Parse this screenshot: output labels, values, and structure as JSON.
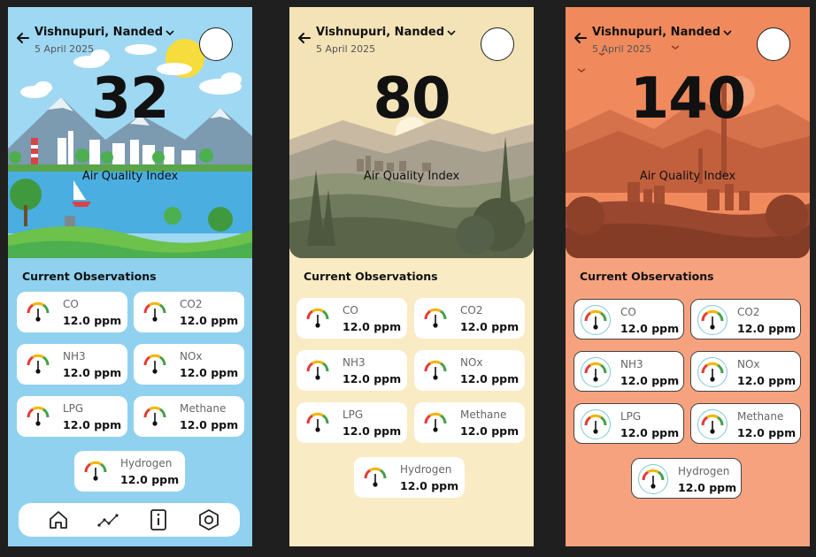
{
  "screens": [
    {
      "location": "Vishnupuri, Nanded",
      "date": "5 April 2025",
      "aqi": "32",
      "aqi_label": "Air Quality Index",
      "observations_title": "Current Observations",
      "theme": {
        "bg": "#8fd1ef",
        "sky": "#9fd8f3"
      },
      "observations": [
        {
          "name": "CO",
          "value": "12.0 ppm"
        },
        {
          "name": "CO2",
          "value": "12.0 ppm"
        },
        {
          "name": "NH3",
          "value": "12.0 ppm"
        },
        {
          "name": "NOx",
          "value": "12.0 ppm"
        },
        {
          "name": "LPG",
          "value": "12.0 ppm"
        },
        {
          "name": "Methane",
          "value": "12.0 ppm"
        },
        {
          "name": "Hydrogen",
          "value": "12.0 ppm"
        }
      ],
      "nav": [
        "home-icon",
        "chart-icon",
        "info-icon",
        "settings-icon"
      ]
    },
    {
      "location": "Vishnupuri, Nanded",
      "date": "5 April 2025",
      "aqi": "80",
      "aqi_label": "Air Quality Index",
      "observations_title": "Current Observations",
      "theme": {
        "bg": "#f9ebc3",
        "sky": "#f3e3b6"
      },
      "observations": [
        {
          "name": "CO",
          "value": "12.0 ppm"
        },
        {
          "name": "CO2",
          "value": "12.0 ppm"
        },
        {
          "name": "NH3",
          "value": "12.0 ppm"
        },
        {
          "name": "NOx",
          "value": "12.0 ppm"
        },
        {
          "name": "LPG",
          "value": "12.0 ppm"
        },
        {
          "name": "Methane",
          "value": "12.0 ppm"
        },
        {
          "name": "Hydrogen",
          "value": "12.0 ppm"
        }
      ]
    },
    {
      "location": "Vishnupuri, Nanded",
      "date": "5 April 2025",
      "aqi": "140",
      "aqi_label": "Air Quality Index",
      "observations_title": "Current Observations",
      "theme": {
        "bg": "#f7a27f",
        "sky": "#f08a5d"
      },
      "observations": [
        {
          "name": "CO",
          "value": "12.0 ppm"
        },
        {
          "name": "CO2",
          "value": "12.0 ppm"
        },
        {
          "name": "NH3",
          "value": "12.0 ppm"
        },
        {
          "name": "NOx",
          "value": "12.0 ppm"
        },
        {
          "name": "LPG",
          "value": "12.0 ppm"
        },
        {
          "name": "Methane",
          "value": "12.0 ppm"
        },
        {
          "name": "Hydrogen",
          "value": "12.0 ppm"
        }
      ]
    }
  ]
}
